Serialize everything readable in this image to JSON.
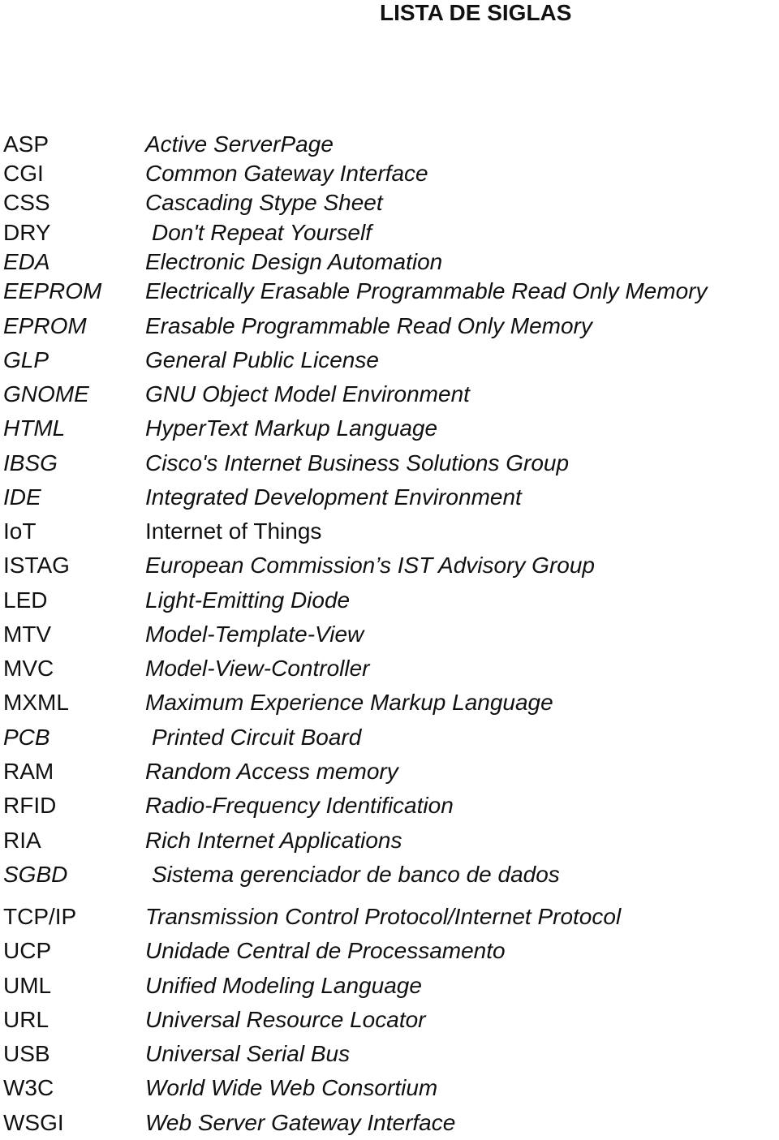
{
  "title": "LISTA DE SIGLAS",
  "entries": [
    {
      "acronym": "ASP",
      "definition": "Active ServerPage"
    },
    {
      "acronym": "CGI",
      "definition": "Common Gateway Interface"
    },
    {
      "acronym": "CSS",
      "definition": "Cascading Stype Sheet"
    },
    {
      "acronym": "DRY",
      "definition": "Don't Repeat Yourself"
    },
    {
      "acronym": "EDA",
      "definition": "Electronic Design Automation"
    },
    {
      "acronym": "EEPROM",
      "definition": "Electrically Erasable Programmable Read Only Memory"
    },
    {
      "acronym": "EPROM",
      "definition": "Erasable Programmable Read Only Memory"
    },
    {
      "acronym": "GLP",
      "definition": "General Public License"
    },
    {
      "acronym": "GNOME",
      "definition": "GNU Object Model Environment"
    },
    {
      "acronym": "HTML",
      "definition": "HyperText Markup Language"
    },
    {
      "acronym": "IBSG",
      "definition": "Cisco's Internet Business Solutions Group"
    },
    {
      "acronym": "IDE",
      "definition": "Integrated Development Environment"
    },
    {
      "acronym": "IoT",
      "definition": "Internet of Things"
    },
    {
      "acronym": "ISTAG",
      "definition": "European Commission’s IST Advisory Group"
    },
    {
      "acronym": "LED",
      "definition": "Light-Emitting Diode"
    },
    {
      "acronym": "MTV",
      "definition": "Model-Template-View"
    },
    {
      "acronym": "MVC",
      "definition": "Model-View-Controller"
    },
    {
      "acronym": "MXML",
      "definition": "Maximum Experience Markup Language"
    },
    {
      "acronym": "PCB",
      "definition": "Printed Circuit Board"
    },
    {
      "acronym": "RAM",
      "definition": "Random Access memory"
    },
    {
      "acronym": "RFID",
      "definition": "Radio-Frequency Identification"
    },
    {
      "acronym": "RIA",
      "definition": "Rich Internet Applications"
    },
    {
      "acronym": "SGBD",
      "definition": "Sistema gerenciador de banco de dados"
    },
    {
      "acronym": "TCP/IP",
      "definition": "Transmission Control Protocol/Internet Protocol"
    },
    {
      "acronym": "UCP",
      "definition": "Unidade Central de Processamento"
    },
    {
      "acronym": "UML",
      "definition": "Unified Modeling Language"
    },
    {
      "acronym": "URL",
      "definition": "Universal Resource Locator"
    },
    {
      "acronym": "USB",
      "definition": "Universal Serial Bus"
    },
    {
      "acronym": "W3C",
      "definition": "World Wide Web Consortium"
    },
    {
      "acronym": "WSGI",
      "definition": "Web Server Gateway Interface"
    }
  ]
}
